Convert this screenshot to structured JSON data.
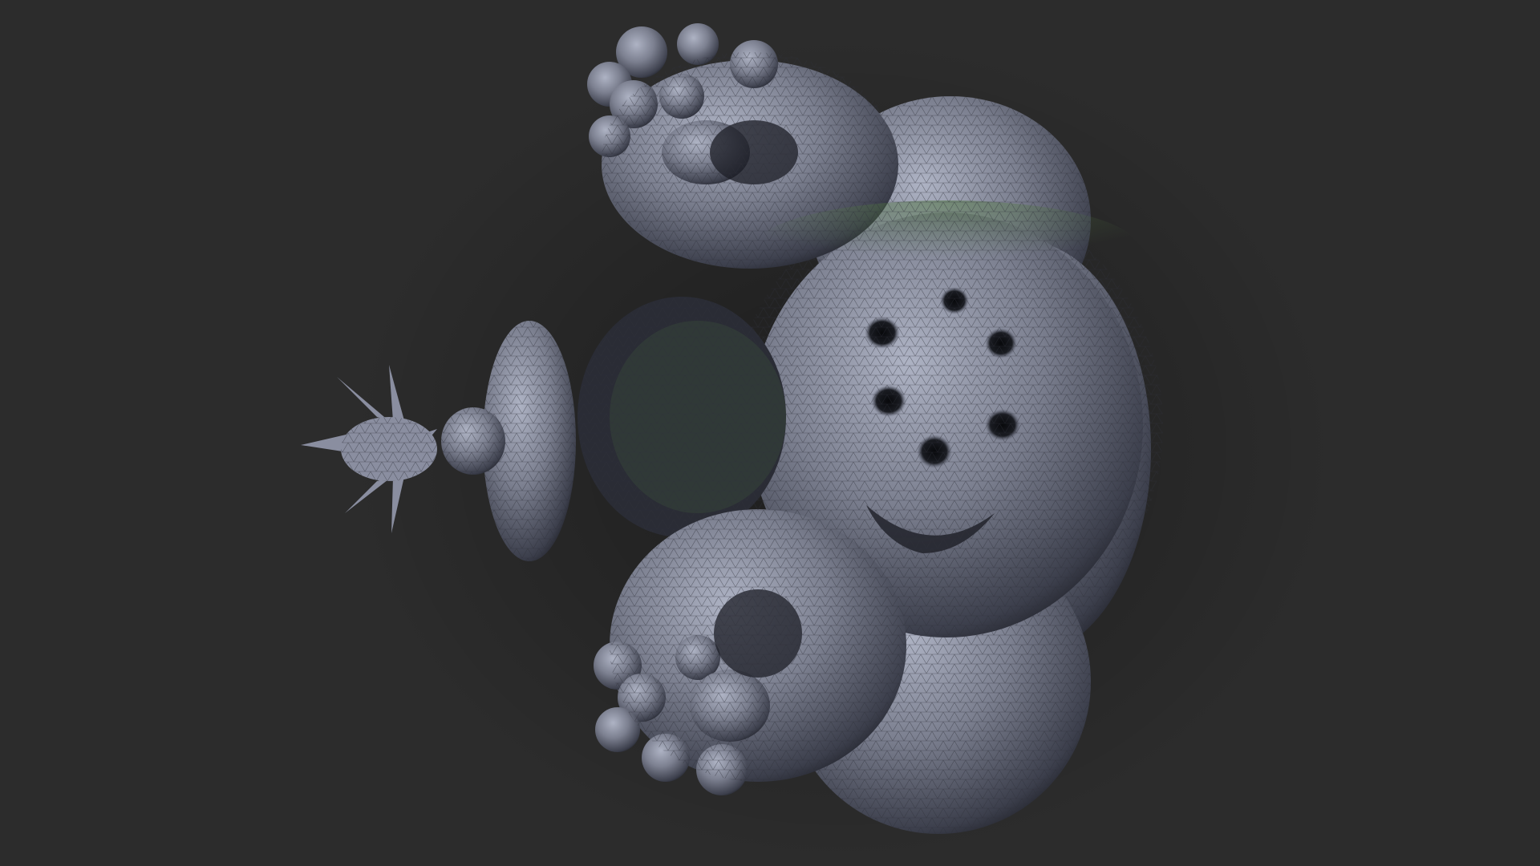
{
  "scene": {
    "subject": "fractal-mesh-model",
    "background_color": "#2c2c2c",
    "mesh_base_color": "#7c8090",
    "mesh_highlight_color": "#aeb3c4",
    "mesh_shadow_color": "#15161c",
    "rim_light_color": "#4f7440",
    "wireframe_color": "#3a3d48",
    "shading": "wireframe-on-shaded"
  }
}
